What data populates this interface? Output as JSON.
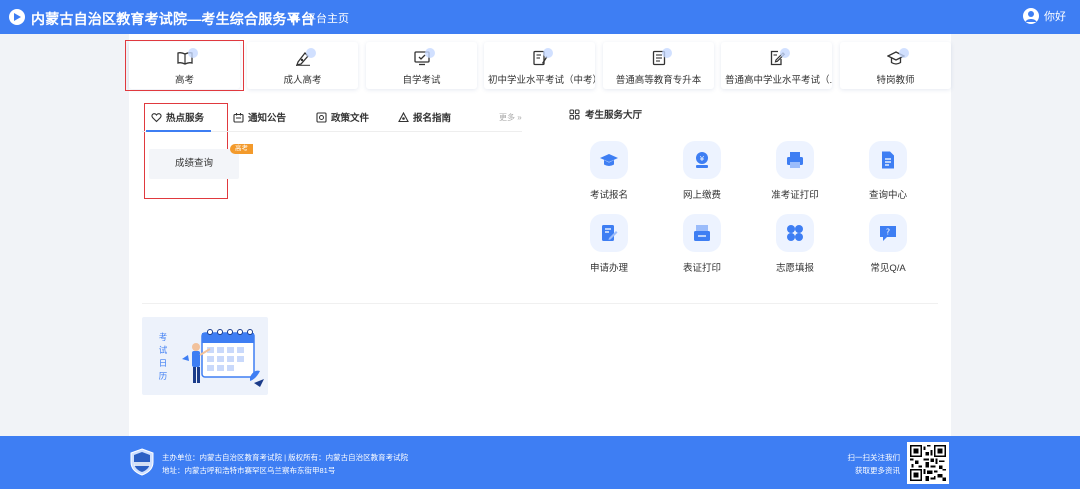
{
  "header": {
    "title": "内蒙古自治区教育考试院—考生综合服务平台",
    "home_label": "平台主页",
    "user_greeting": "你好"
  },
  "exam_tabs": [
    {
      "label": "高考",
      "icon": "book-open-icon"
    },
    {
      "label": "成人高考",
      "icon": "pen-nib-icon"
    },
    {
      "label": "自学考试",
      "icon": "monitor-check-icon"
    },
    {
      "label": "初中学业水平考试（中考）",
      "icon": "checklist-pen-icon"
    },
    {
      "label": "普通高等教育专升本",
      "icon": "document-lines-icon"
    },
    {
      "label": "普通高中学业水平考试（...",
      "icon": "edit-document-icon"
    },
    {
      "label": "特岗教师",
      "icon": "graduation-cap-icon"
    }
  ],
  "info_tabs": [
    {
      "label": "热点服务",
      "icon": "heart-tag-icon"
    },
    {
      "label": "通知公告",
      "icon": "notice-icon"
    },
    {
      "label": "政策文件",
      "icon": "policy-file-icon"
    },
    {
      "label": "报名指南",
      "icon": "guide-icon"
    }
  ],
  "more_label": "更多 »",
  "hot_service": {
    "label": "成绩查询",
    "badge": "高考"
  },
  "hall": {
    "title": "考生服务大厅",
    "items": [
      {
        "label": "考试报名",
        "icon": "cap-icon"
      },
      {
        "label": "网上缴费",
        "icon": "payment-icon"
      },
      {
        "label": "准考证打印",
        "icon": "printer-icon"
      },
      {
        "label": "查询中心",
        "icon": "search-doc-icon"
      },
      {
        "label": "申请办理",
        "icon": "apply-icon"
      },
      {
        "label": "表证打印",
        "icon": "form-print-icon"
      },
      {
        "label": "志愿填报",
        "icon": "clover-icon"
      },
      {
        "label": "常见Q/A",
        "icon": "qa-icon"
      }
    ]
  },
  "calendar": {
    "label": "考试日历"
  },
  "footer": {
    "line1": "主办单位：内蒙古自治区教育考试院 | 版权所有：内蒙古自治区教育考试院",
    "line2": "地址：内蒙古呼和浩特市赛罕区乌兰察布东街甲81号",
    "follow1": "扫一扫关注我们",
    "follow2": "获取更多资讯"
  },
  "colors": {
    "primary": "#3e7ef3",
    "highlight": "#e0393e",
    "badge": "#f39a2b"
  }
}
